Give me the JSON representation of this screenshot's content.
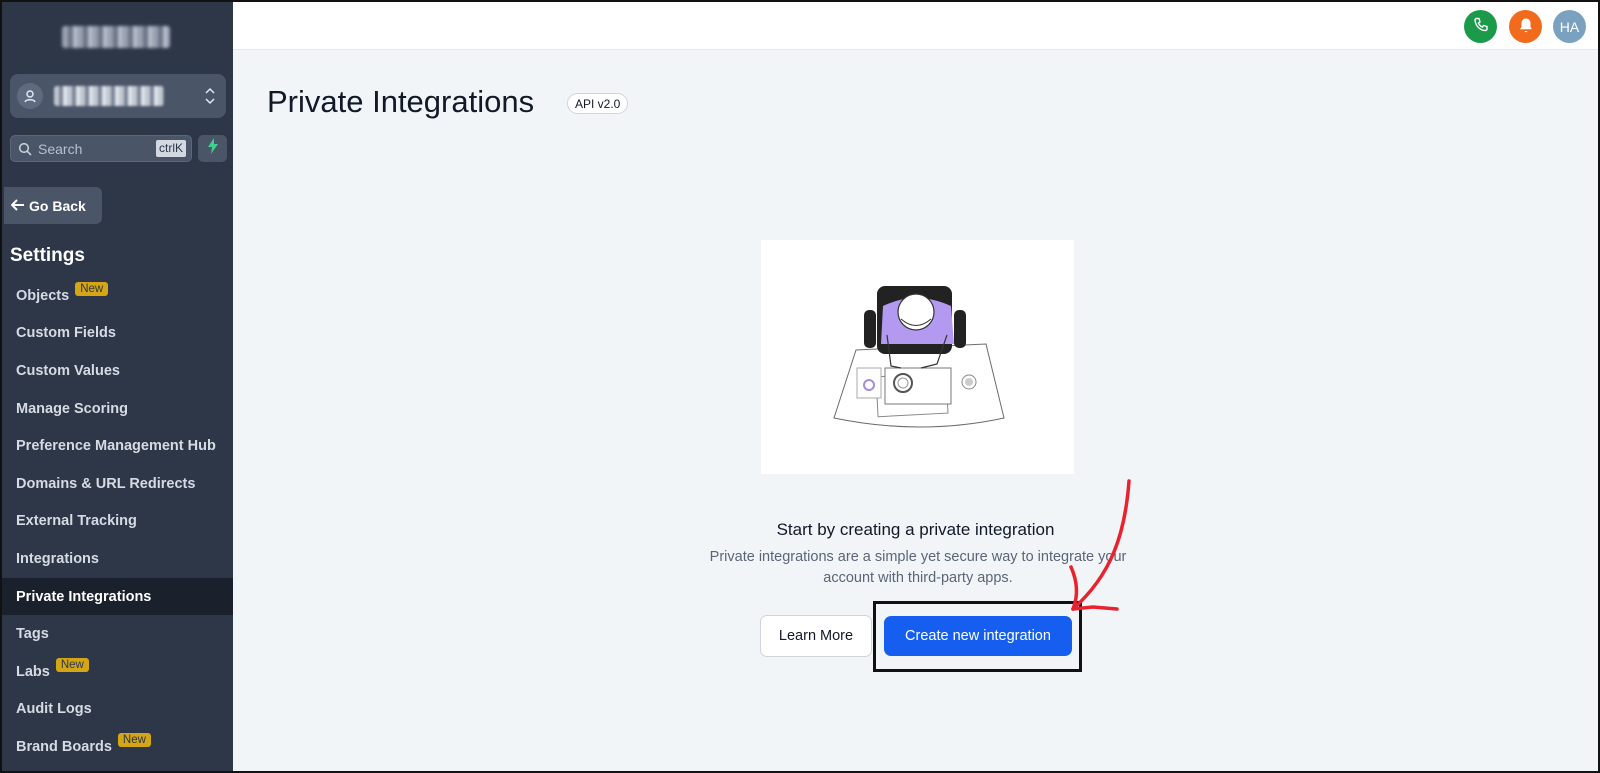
{
  "sidebar": {
    "search_placeholder": "Search",
    "search_shortcut": "ctrlK",
    "go_back_label": "Go Back",
    "section_title": "Settings",
    "items": [
      {
        "label": "Objects",
        "badge": "New"
      },
      {
        "label": "Custom Fields",
        "badge": ""
      },
      {
        "label": "Custom Values",
        "badge": ""
      },
      {
        "label": "Manage Scoring",
        "badge": ""
      },
      {
        "label": "Preference Management Hub",
        "badge": ""
      },
      {
        "label": "Domains & URL Redirects",
        "badge": ""
      },
      {
        "label": "External Tracking",
        "badge": ""
      },
      {
        "label": "Integrations",
        "badge": ""
      },
      {
        "label": "Private Integrations",
        "badge": "",
        "active": true
      },
      {
        "label": "Tags",
        "badge": ""
      },
      {
        "label": "Labs",
        "badge": "New"
      },
      {
        "label": "Audit Logs",
        "badge": ""
      },
      {
        "label": "Brand Boards",
        "badge": "New"
      }
    ]
  },
  "topbar": {
    "user_initials": "HA",
    "icons": [
      "phone-icon",
      "bell-icon"
    ]
  },
  "main": {
    "title": "Private Integrations",
    "api_badge": "API v2.0",
    "empty_title": "Start by creating a private integration",
    "empty_subtitle": "Private integrations are a simple yet secure way to integrate your account with third-party apps.",
    "learn_more_label": "Learn More",
    "create_label": "Create new integration"
  },
  "colors": {
    "sidebar_bg": "#2d3748",
    "primary": "#155eef",
    "phone": "#1b9a4a",
    "bell": "#f26a1b",
    "badge": "#d4a514",
    "annotation_arrow": "#e8232f"
  }
}
